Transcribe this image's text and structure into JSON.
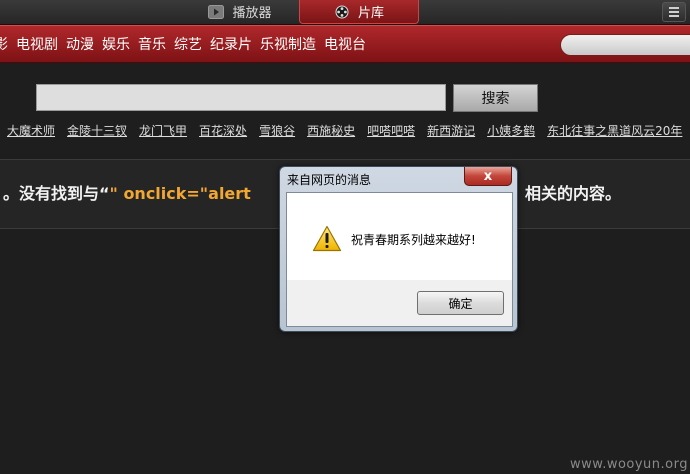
{
  "topbar": {
    "tabs": [
      {
        "label": "播放器",
        "icon": "play-icon"
      },
      {
        "label": "片库",
        "icon": "film-reel-icon"
      }
    ],
    "menu_icon": "menu-icon"
  },
  "categories": [
    "影",
    "电视剧",
    "动漫",
    "娱乐",
    "音乐",
    "综艺",
    "纪录片",
    "乐视制造",
    "电视台"
  ],
  "search": {
    "value": "",
    "button_label": "搜索"
  },
  "hot_links": [
    "大魔术师",
    "金陵十三钗",
    "龙门飞甲",
    "百花深处",
    "雪狼谷",
    "西施秘史",
    "吧嗒吧嗒",
    "新西游记",
    "小姨多鹤",
    "东北往事之黑道风云20年"
  ],
  "result": {
    "prefix": "。没有找到与“",
    "query": "\" onclick=\"alert",
    "suffix": "相关的内容。"
  },
  "dialog": {
    "title": "来自网页的消息",
    "close_label": "x",
    "message": "祝青春期系列越来越好!",
    "ok_label": "确定",
    "icon": "warning-icon"
  },
  "watermark": "www.wooyun.org",
  "colors": {
    "accent_red": "#9a1e21",
    "query_orange": "#f2a733",
    "background": "#1e1e1e"
  }
}
